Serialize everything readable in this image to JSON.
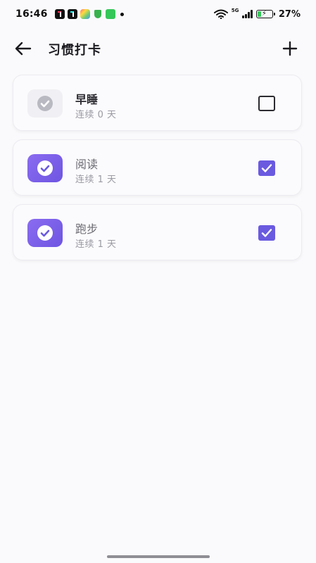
{
  "status_bar": {
    "time": "16:46",
    "network_label": "5G",
    "battery_percent": "27%",
    "battery_level": 0.27
  },
  "header": {
    "title": "习惯打卡",
    "back_icon": "arrow-left-icon",
    "add_icon": "plus-icon"
  },
  "habits": [
    {
      "name": "早睡",
      "streak": "连续 0 天",
      "checked": false
    },
    {
      "name": "阅读",
      "streak": "连续 1 天",
      "checked": true
    },
    {
      "name": "跑步",
      "streak": "连续 1 天",
      "checked": true
    }
  ],
  "colors": {
    "accent": "#6a5ae0",
    "icon_gradient_start": "#8a6cf0",
    "icon_gradient_end": "#6e55e2",
    "inactive_icon_bg": "#f0f0f4",
    "background": "#fafafc"
  }
}
